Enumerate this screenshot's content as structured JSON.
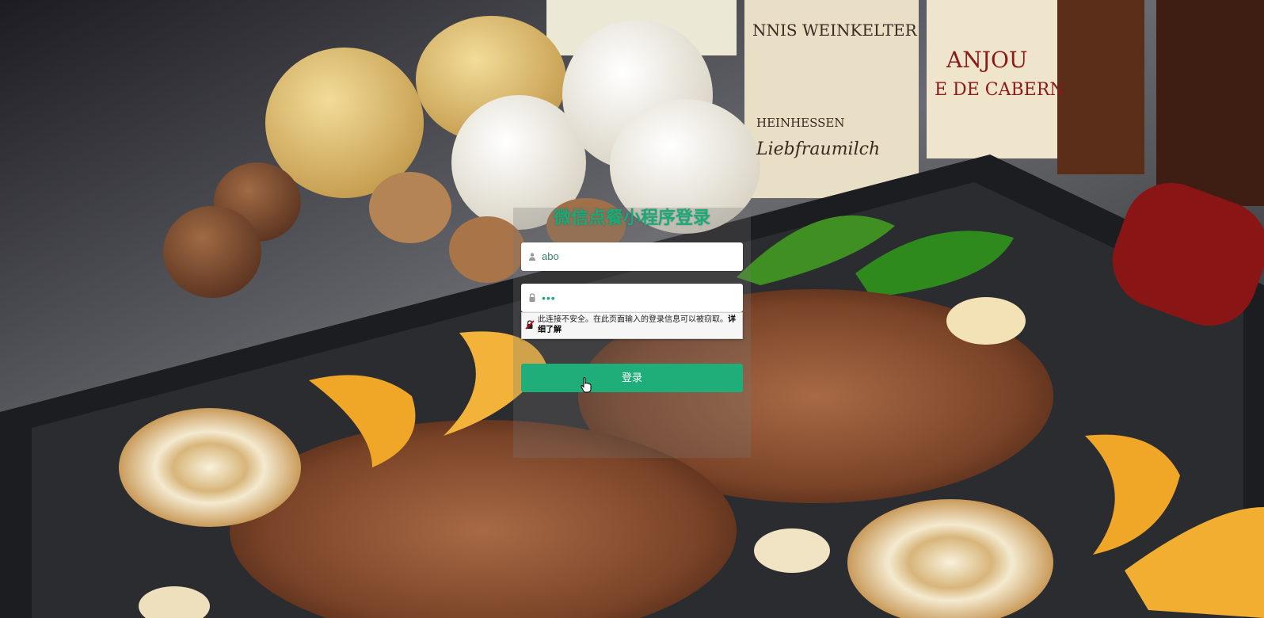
{
  "login": {
    "title": "微信点餐小程序登录",
    "username": {
      "value": "abo",
      "icon": "user-icon"
    },
    "password": {
      "masked_value": "•••",
      "icon": "lock-icon"
    },
    "warning": {
      "icon": "insecure-connection-icon",
      "message": "此连接不安全。在此页面输入的登录信息可以被窃取。",
      "link": "详细了解"
    },
    "submit_label": "登录"
  },
  "background": {
    "label_1": "NNIS WEINKELTER",
    "label_2": "ANJOU",
    "label_3": "E DE CABERN",
    "label_4": "HEINHESSEN",
    "label_5": "Liebfraumilch"
  },
  "colors": {
    "accent": "#1fad7a",
    "title": "#1aaa78"
  }
}
